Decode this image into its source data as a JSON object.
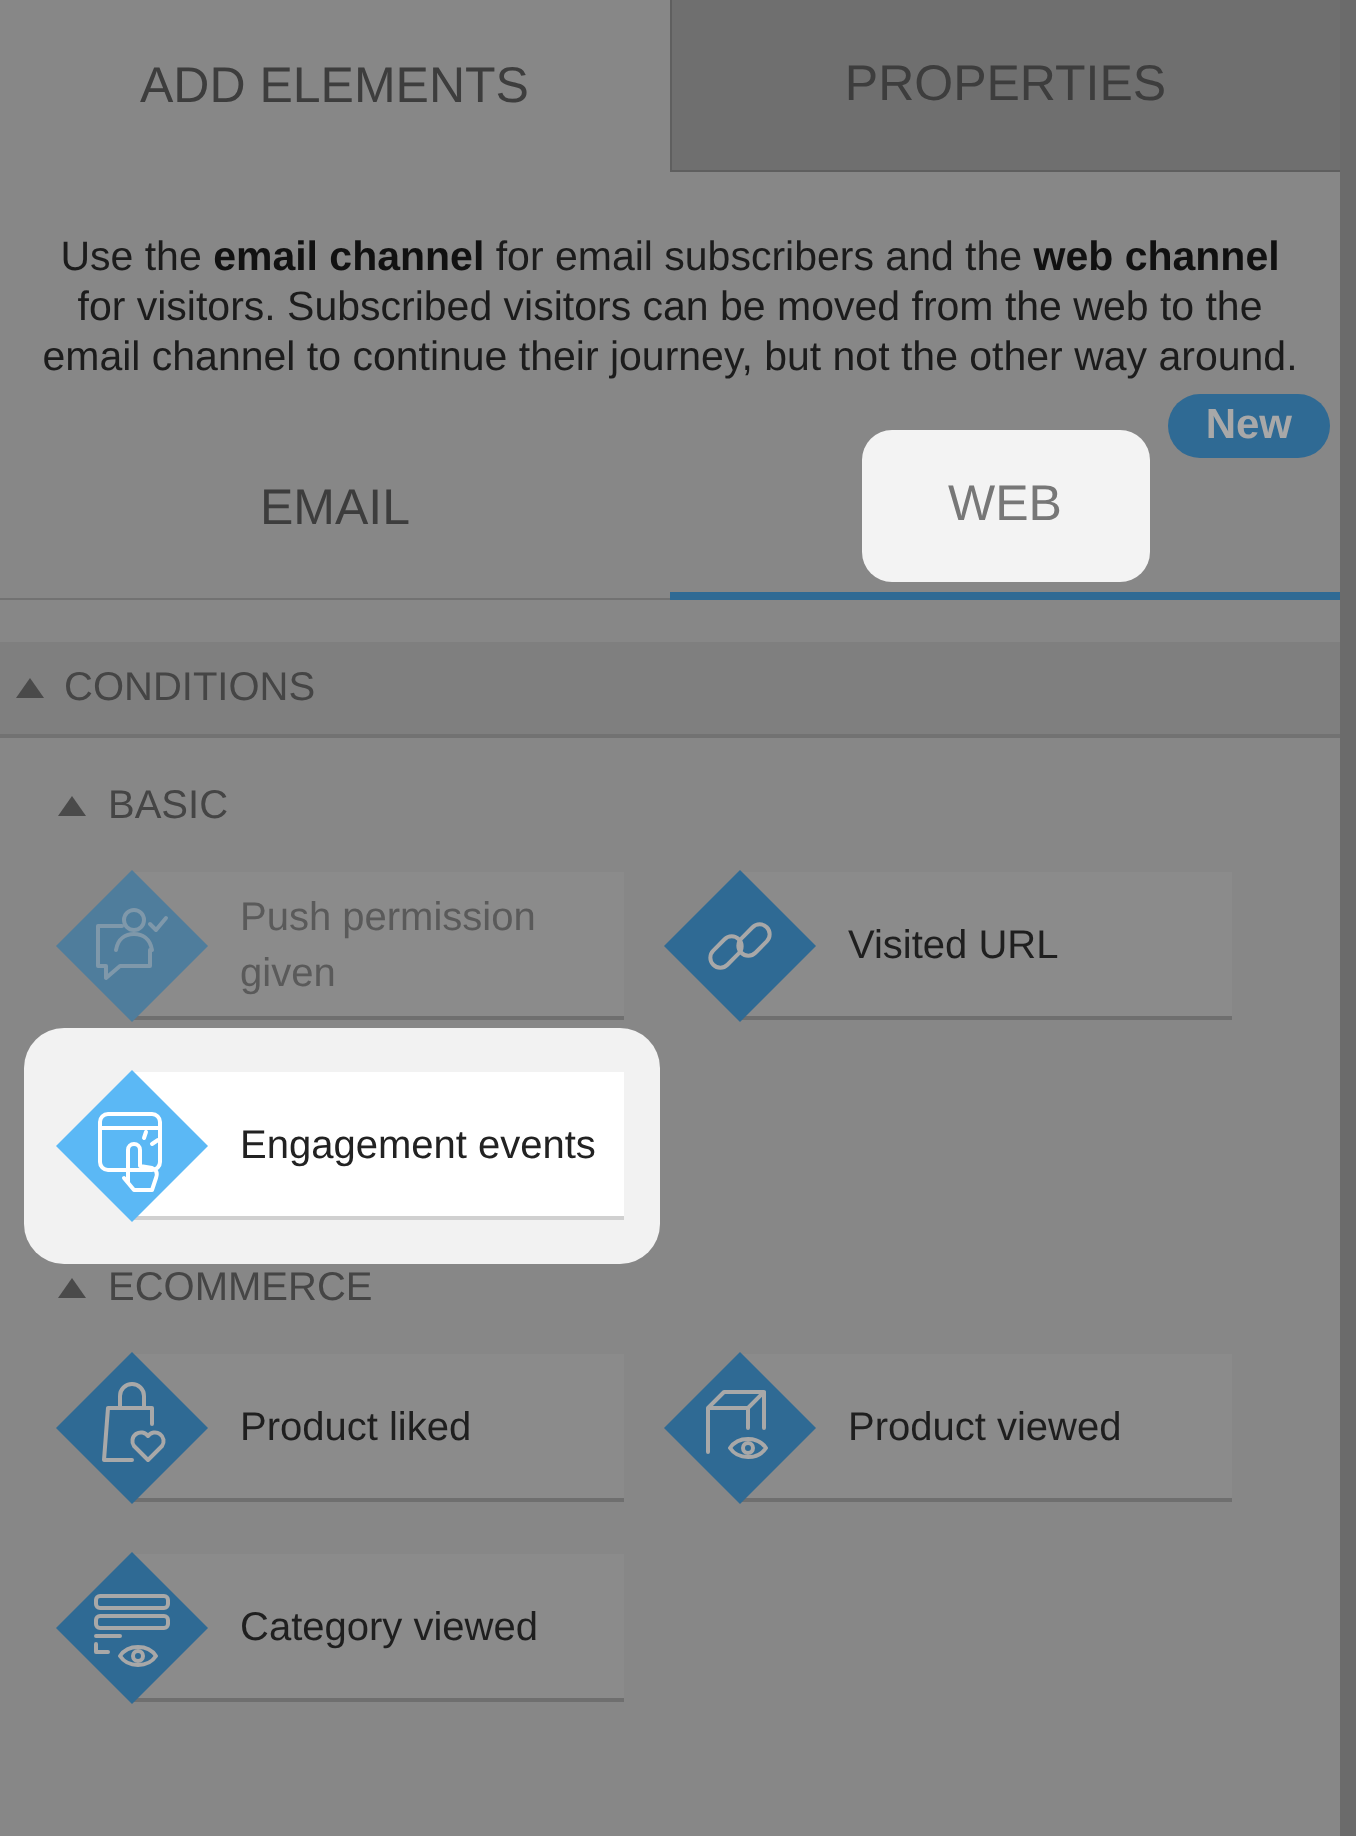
{
  "tabs": [
    {
      "label": "ADD ELEMENTS",
      "selected": true
    },
    {
      "label": "PROPERTIES",
      "selected": false
    }
  ],
  "description": "Use the **email channel** for email subscribers and the **web channel** for visitors. Subscribed visitors can be moved from the web to the email channel to continue their journey, but not the other way around.",
  "channels": [
    {
      "label": "EMAIL",
      "selected": false,
      "spotlight": false
    },
    {
      "label": "WEB",
      "selected": true,
      "spotlight": true,
      "badge": "New"
    }
  ],
  "section": {
    "title": "CONDITIONS",
    "expanded": true,
    "groups": [
      {
        "title": "BASIC",
        "expanded": true,
        "items": [
          {
            "kind": "push",
            "label": "Push permission given",
            "disabled": true,
            "spotlight": false
          },
          {
            "kind": "url",
            "label": "Visited URL",
            "disabled": false,
            "spotlight": false
          },
          {
            "kind": "engagement",
            "label": "Engagement events",
            "disabled": false,
            "spotlight": true
          }
        ]
      },
      {
        "title": "ECOMMERCE",
        "expanded": true,
        "items": [
          {
            "kind": "liked",
            "label": "Product liked",
            "disabled": false,
            "spotlight": false
          },
          {
            "kind": "product",
            "label": "Product viewed",
            "disabled": false,
            "spotlight": false
          },
          {
            "kind": "category",
            "label": "Category viewed",
            "disabled": false,
            "spotlight": false
          }
        ]
      }
    ]
  }
}
